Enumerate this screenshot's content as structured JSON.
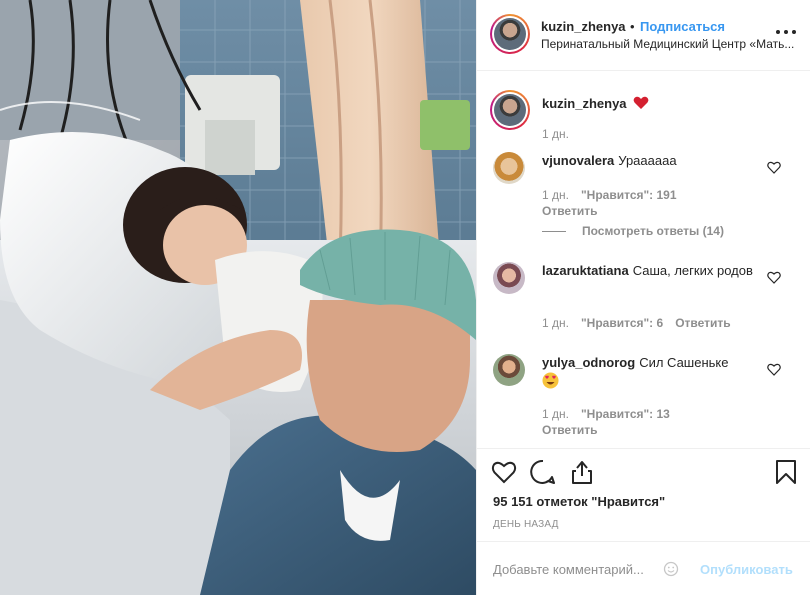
{
  "post": {
    "author": "kuzin_zhenya",
    "separator": "•",
    "follow_label": "Подписаться",
    "location": "Перинатальный Медицинский Центр «Мать...",
    "caption_time": "1 дн."
  },
  "comments": [
    {
      "username": "vjunovalera",
      "text": "Ураааааа",
      "time": "1 дн.",
      "likes": "\"Нравится\": 191",
      "reply_label": "Ответить",
      "view_replies": "Посмотреть ответы (14)"
    },
    {
      "username": "lazaruktatiana",
      "text": "Саша, легких родов",
      "time": "1 дн.",
      "likes": "\"Нравится\": 6",
      "reply_label": "Ответить"
    },
    {
      "username": "yulya_odnorog",
      "text": "Сил Сашеньке",
      "time": "1 дн.",
      "likes": "\"Нравится\": 13",
      "reply_label": "Ответить"
    }
  ],
  "actions": {
    "likes_count": "95 151 отметок \"Нравится\"",
    "post_time": "ДЕНЬ НАЗАД"
  },
  "add_comment": {
    "placeholder": "Добавьте комментарий...",
    "publish_label": "Опубликовать"
  },
  "colors": {
    "link_blue": "#3897f0",
    "publish_disabled": "#b2dffc",
    "heart_red": "#ed4956",
    "secondary_text": "#8e8e8e"
  },
  "icons": [
    "heart-outline-icon",
    "comment-icon",
    "share-icon",
    "bookmark-icon",
    "more-options-icon",
    "heart-emoji-icon",
    "emoji-icon"
  ]
}
